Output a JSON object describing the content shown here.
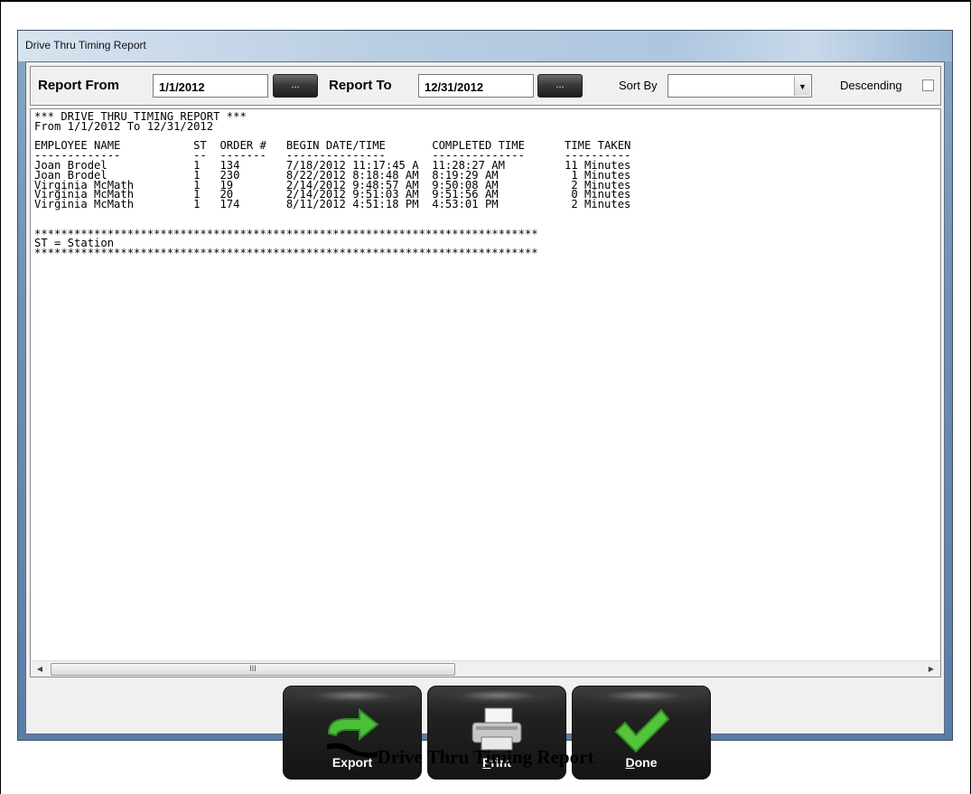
{
  "window": {
    "title": "Drive Thru Timing Report"
  },
  "filters": {
    "report_from_label": "Report From",
    "report_from_value": "1/1/2012",
    "report_to_label": "Report To",
    "report_to_value": "12/31/2012",
    "picker_label": "...",
    "sort_by_label": "Sort By",
    "sort_by_value": "",
    "descending_label": "Descending"
  },
  "report": {
    "lines": [
      "*** DRIVE THRU TIMING REPORT ***",
      "From 1/1/2012 To 12/31/2012",
      "",
      "EMPLOYEE NAME           ST  ORDER #   BEGIN DATE/TIME       COMPLETED TIME      TIME TAKEN",
      "-------------           --  -------   ---------------       --------------      ----------",
      "Joan Brodel             1   134       7/18/2012 11:17:45 A  11:28:27 AM         11 Minutes",
      "Joan Brodel             1   230       8/22/2012 8:18:48 AM  8:19:29 AM           1 Minutes",
      "Virginia McMath         1   19        2/14/2012 9:48:57 AM  9:50:08 AM           2 Minutes",
      "Virginia McMath         1   20        2/14/2012 9:51:03 AM  9:51:56 AM           0 Minutes",
      "Virginia McMath         1   174       8/11/2012 4:51:18 PM  4:53:01 PM           2 Minutes",
      "",
      "",
      "****************************************************************************",
      "ST = Station",
      "****************************************************************************"
    ]
  },
  "scrollbar": {
    "left_arrow": "◀",
    "right_arrow": "▶",
    "thumb_grip": "III"
  },
  "buttons": {
    "export_label": "Export",
    "print_label": "Print",
    "done_label": "Done"
  },
  "caption": "Drive Thru Timing Report"
}
